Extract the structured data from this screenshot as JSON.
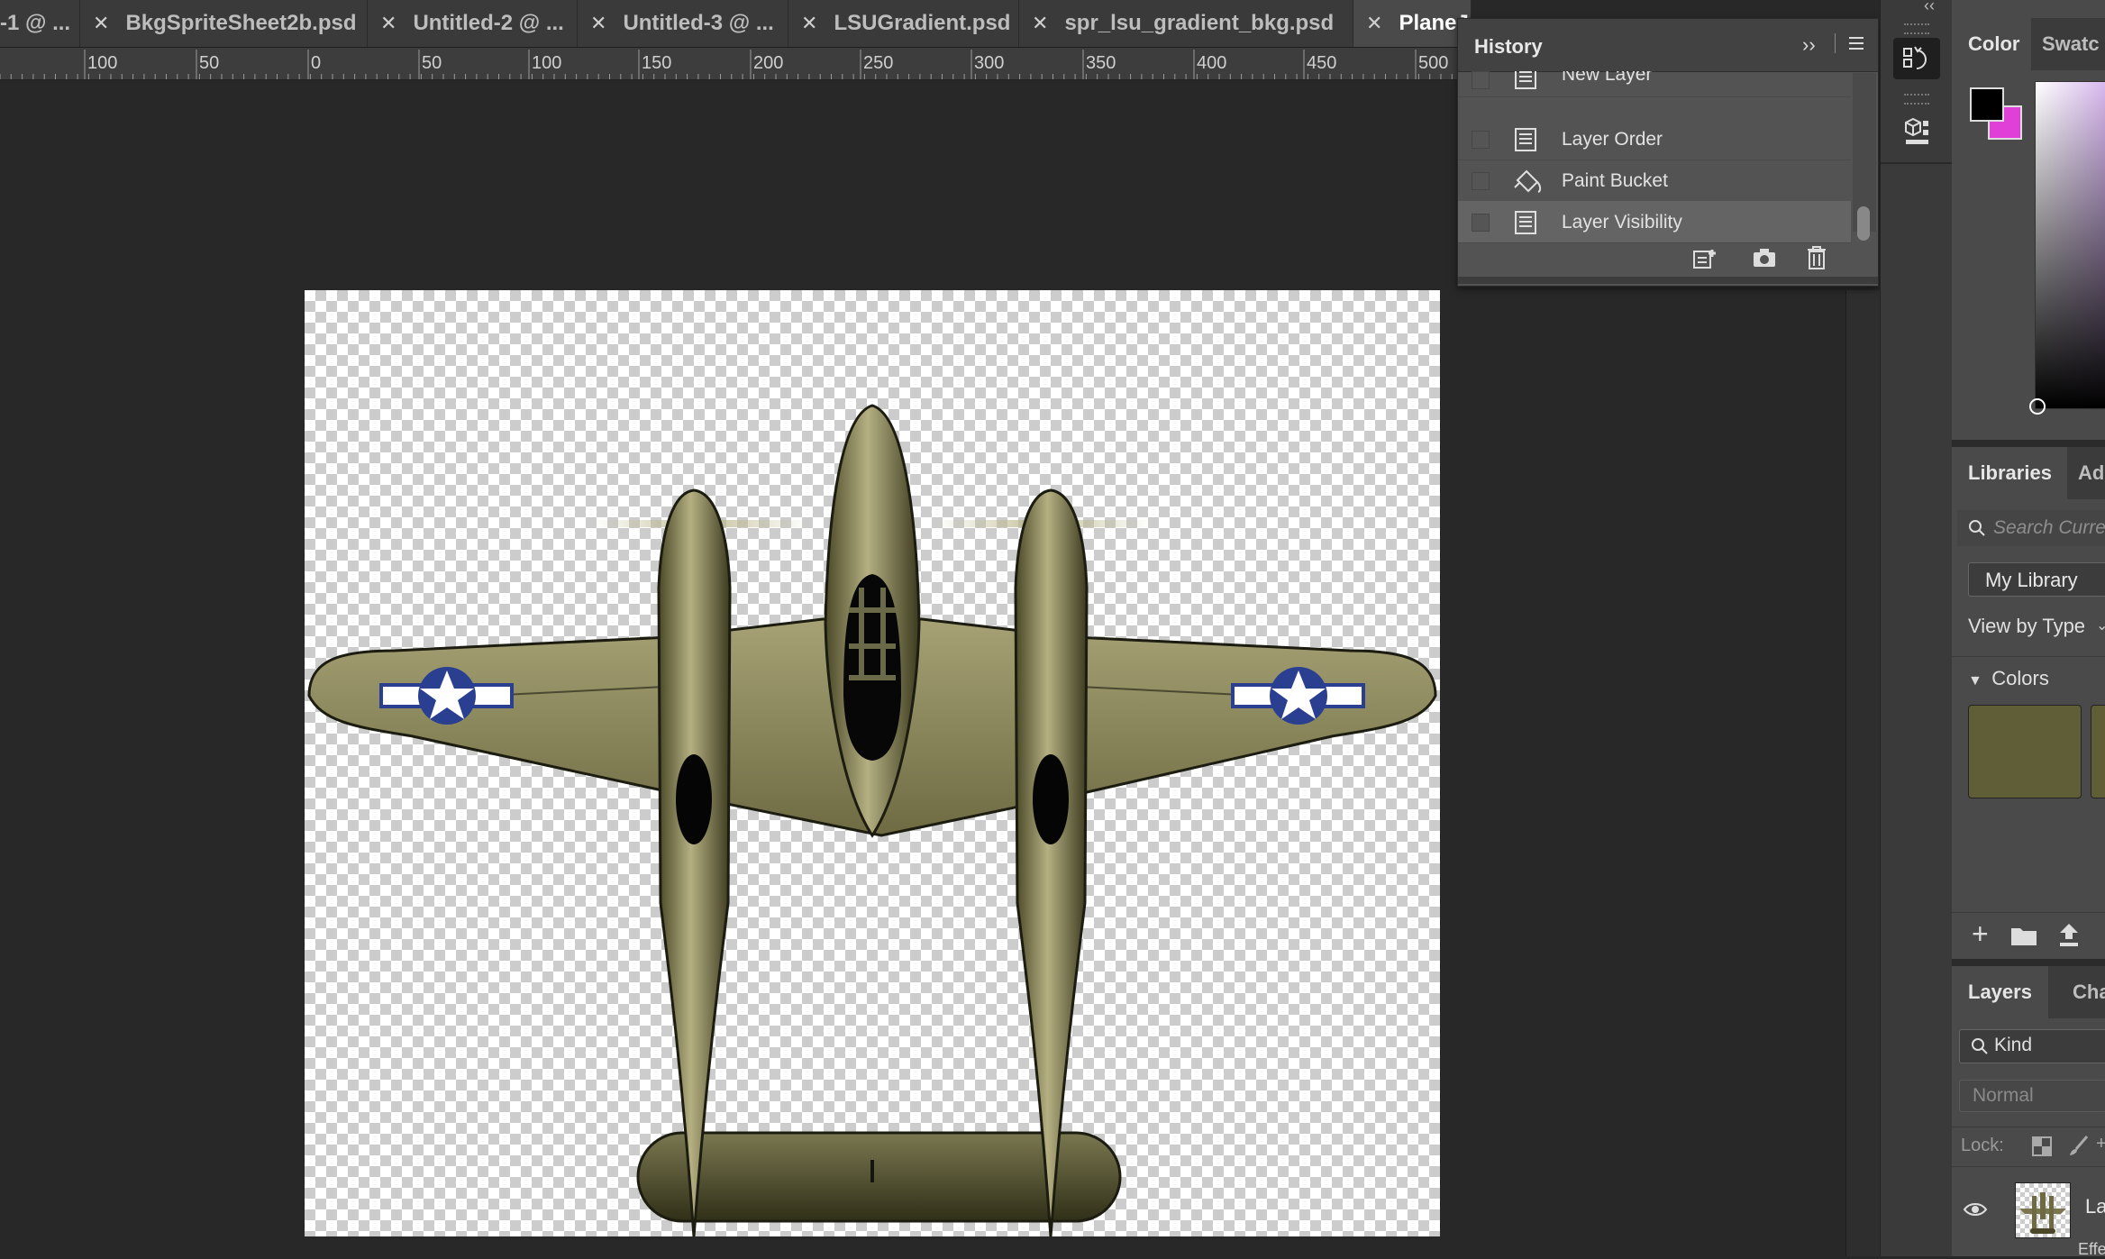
{
  "tabs": [
    {
      "label": "-1 @ ...",
      "active": false
    },
    {
      "label": "BkgSpriteSheet2b.psd",
      "active": false
    },
    {
      "label": "Untitled-2 @ ...",
      "active": false
    },
    {
      "label": "Untitled-3 @ ...",
      "active": false
    },
    {
      "label": "LSUGradient.psd",
      "active": false
    },
    {
      "label": "spr_lsu_gradient_bkg.psd",
      "active": false
    },
    {
      "label": "PlaneJp",
      "active": true
    }
  ],
  "ruler_labels": [
    "100",
    "50",
    "0",
    "50",
    "100",
    "150",
    "200",
    "250",
    "300",
    "350",
    "400",
    "450",
    "500"
  ],
  "history": {
    "title": "History",
    "items": [
      {
        "label": "New Layer",
        "icon": "history-state-icon"
      },
      {
        "label": "Layer Order",
        "icon": "history-state-icon"
      },
      {
        "label": "Paint Bucket",
        "icon": "paint-bucket-icon"
      },
      {
        "label": "Layer Visibility",
        "icon": "history-state-icon",
        "selected": true
      }
    ]
  },
  "color_panel": {
    "tab_color": "Color",
    "tab_swatches": "Swatc",
    "foreground": "#000000",
    "background": "#e040d8"
  },
  "libraries": {
    "tab_libraries": "Libraries",
    "tab_other": "Ad",
    "search_placeholder": "Search Curre",
    "library_name": "My Library",
    "view_by": "View by Type",
    "colors_label": "Colors",
    "swatches": [
      "#5f5e36",
      "#5f5e36"
    ]
  },
  "layers": {
    "tab_layers": "Layers",
    "tab_other": "Char",
    "filter_kind": "Kind",
    "blend_mode": "Normal",
    "lock_label": "Lock:",
    "layer_name": "La",
    "effects_label": "Effe"
  },
  "colors": {
    "plane_olive": "#8a8656",
    "roundel_blue": "#2a3f8f"
  }
}
